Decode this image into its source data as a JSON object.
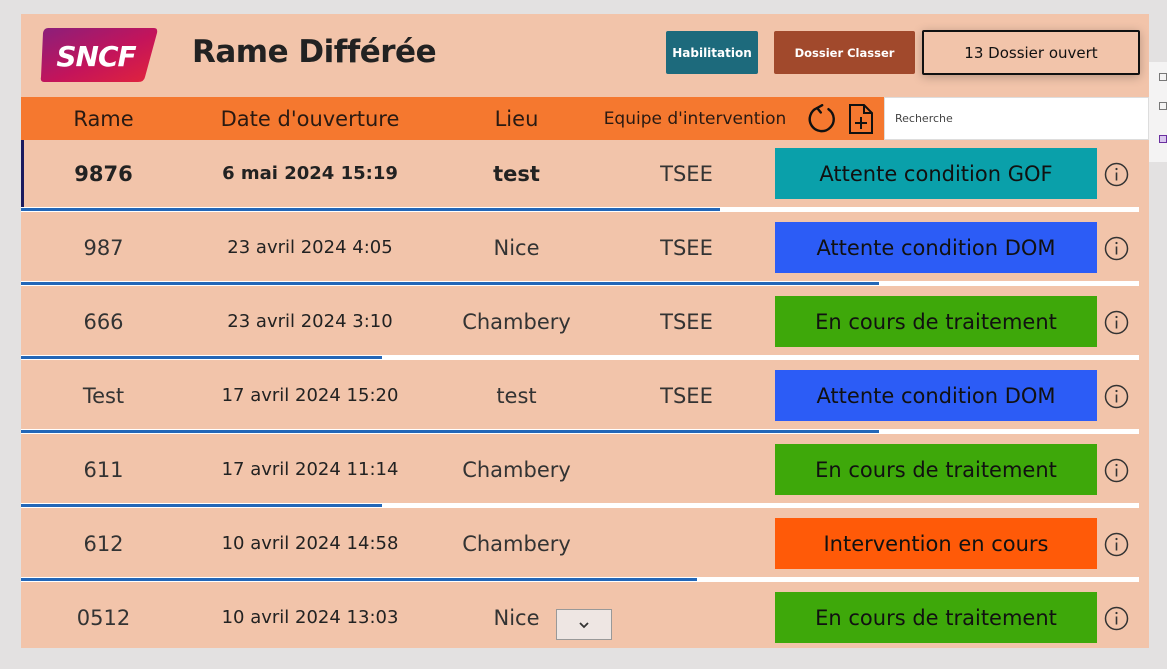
{
  "header": {
    "logo_text": "SNCF",
    "title": "Rame Différée",
    "buttons": {
      "habilitation": "Habilitation",
      "dossier_classer": "Dossier Classer",
      "dossier_ouvert": "13 Dossier ouvert"
    }
  },
  "columns": {
    "rame": "Rame",
    "date": "Date d'ouverture",
    "lieu": "Lieu",
    "equipe": "Equipe d'intervention"
  },
  "search": {
    "placeholder": "Recherche",
    "value": ""
  },
  "icons": {
    "refresh": "refresh-icon",
    "add_file": "add-file-icon",
    "info": "info-icon",
    "dropdown": "chevron-down-icon"
  },
  "colors": {
    "background": "#f2c4aa",
    "header_bar": "#f5782f",
    "progress": "#2367b8",
    "habilitation": "#1d6a7c",
    "dossier_classer": "#a1492c",
    "status_gof": "#0aa0aa",
    "status_dom": "#2c5cf6",
    "status_traitement": "#3ea80a",
    "status_intervention": "#ff5a08"
  },
  "rows": [
    {
      "rame": "9876",
      "date": "6 mai 2024 15:19",
      "lieu": "test",
      "equipe": "TSEE",
      "status": "Attente condition GOF",
      "status_color": "#0aa0aa",
      "progress": 0.625,
      "selected": true
    },
    {
      "rame": "987",
      "date": "23 avril 2024 4:05",
      "lieu": "Nice",
      "equipe": "TSEE",
      "status": "Attente condition DOM",
      "status_color": "#2c5cf6",
      "progress": 0.767
    },
    {
      "rame": "666",
      "date": "23 avril 2024 3:10",
      "lieu": "Chambery",
      "equipe": "TSEE",
      "status": "En cours de traitement",
      "status_color": "#3ea80a",
      "progress": 0.323
    },
    {
      "rame": "Test",
      "date": "17 avril 2024 15:20",
      "lieu": "test",
      "equipe": "TSEE",
      "status": "Attente condition DOM",
      "status_color": "#2c5cf6",
      "progress": 0.767
    },
    {
      "rame": "611",
      "date": "17 avril 2024 11:14",
      "lieu": "Chambery",
      "equipe": "",
      "status": "En cours de traitement",
      "status_color": "#3ea80a",
      "progress": 0.323
    },
    {
      "rame": "612",
      "date": "10 avril 2024 14:58",
      "lieu": "Chambery",
      "equipe": "",
      "status": "Intervention en cours",
      "status_color": "#ff5a08",
      "progress": 0.605
    },
    {
      "rame": "0512",
      "date": "10 avril 2024 13:03",
      "lieu": "Nice",
      "equipe": "",
      "status": "En cours de traitement",
      "status_color": "#3ea80a",
      "progress": null,
      "has_dropdown": true
    }
  ]
}
